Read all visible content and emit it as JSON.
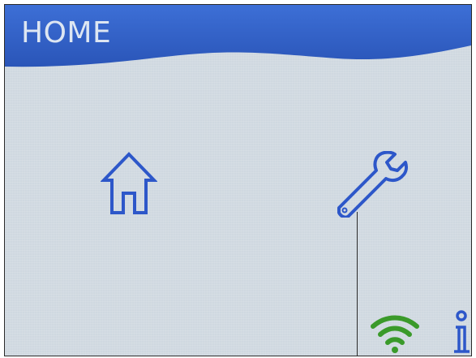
{
  "header": {
    "title": "HOME",
    "color": "#2f5fc4"
  },
  "icons": {
    "home": "home-icon",
    "settings": "wrench-icon",
    "wifi": "wifi-icon",
    "info": "info-icon"
  },
  "colors": {
    "icon_blue": "#2d57c9",
    "wifi_green": "#3a9a2a",
    "screen_bg": "#cfd8e0"
  }
}
